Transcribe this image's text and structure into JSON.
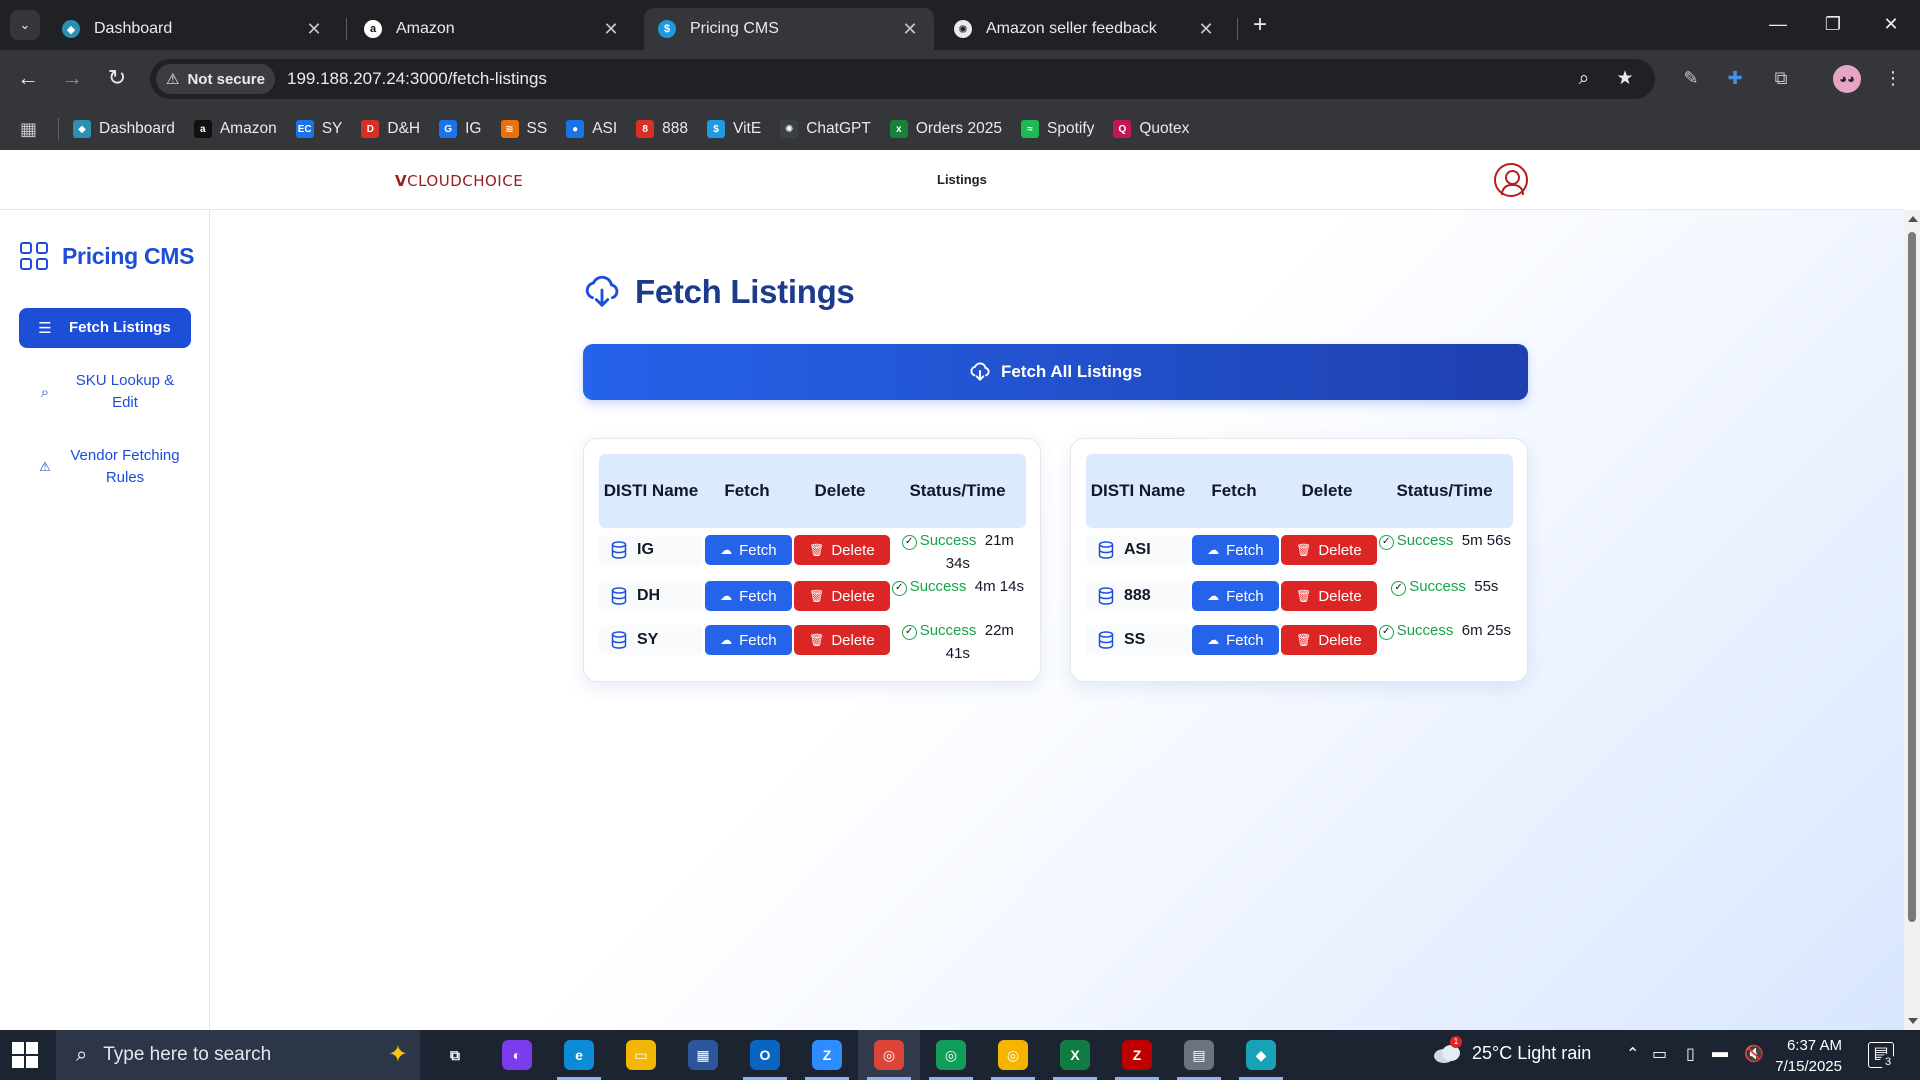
{
  "browser": {
    "tabs": [
      {
        "title": "Dashboard",
        "icon": "dashboard-favicon",
        "icon_color": "#2b8fb0",
        "active": false
      },
      {
        "title": "Amazon",
        "icon": "amazon-favicon",
        "icon_color": "#ffffff",
        "active": false
      },
      {
        "title": "Pricing CMS",
        "icon": "dollar-favicon",
        "icon_color": "#1f9ae0",
        "active": true
      },
      {
        "title": "Amazon seller feedback",
        "icon": "chatgpt-favicon",
        "icon_color": "#e8eaed",
        "active": false
      }
    ],
    "security_label": "Not secure",
    "url": "199.188.207.24:3000/fetch-listings",
    "bookmarks": [
      {
        "label": "Dashboard",
        "icon": "dashboard-bookmark-icon",
        "color": "#2b8fb0",
        "glyph": "◆"
      },
      {
        "label": "Amazon",
        "icon": "amazon-bookmark-icon",
        "color": "#111111",
        "glyph": "a"
      },
      {
        "label": "SY",
        "icon": "sy-bookmark-icon",
        "color": "#1a73e8",
        "glyph": "EC"
      },
      {
        "label": "D&H",
        "icon": "dh-bookmark-icon",
        "color": "#d93025",
        "glyph": "D"
      },
      {
        "label": "IG",
        "icon": "ig-bookmark-icon",
        "color": "#1a73e8",
        "glyph": "G"
      },
      {
        "label": "SS",
        "icon": "ss-bookmark-icon",
        "color": "#e8710a",
        "glyph": "≋"
      },
      {
        "label": "ASI",
        "icon": "asi-bookmark-icon",
        "color": "#1a73e8",
        "glyph": "●"
      },
      {
        "label": "888",
        "icon": "888-bookmark-icon",
        "color": "#d93025",
        "glyph": "8"
      },
      {
        "label": "VitE",
        "icon": "vite-bookmark-icon",
        "color": "#1f9ae0",
        "glyph": "$"
      },
      {
        "label": "ChatGPT",
        "icon": "chatgpt-bookmark-icon",
        "color": "#3c4043",
        "glyph": "✺"
      },
      {
        "label": "Orders 2025",
        "icon": "orders-bookmark-icon",
        "color": "#188038",
        "glyph": "x"
      },
      {
        "label": "Spotify",
        "icon": "spotify-bookmark-icon",
        "color": "#1db954",
        "glyph": "≈"
      },
      {
        "label": "Quotex",
        "icon": "quotex-bookmark-icon",
        "color": "#c2185b",
        "glyph": "Q"
      }
    ]
  },
  "app": {
    "logo_prefix": "V",
    "logo_text": "CLOUDCHOICE",
    "header_link": "Listings",
    "brand": "Pricing CMS",
    "sidebar": [
      {
        "label": "Fetch Listings",
        "icon": "list-icon",
        "glyph": "☰",
        "active": true
      },
      {
        "label": "SKU Lookup & Edit",
        "icon": "search-icon",
        "glyph": "⌕",
        "active": false
      },
      {
        "label": "Vendor Fetching Rules",
        "icon": "warning-icon",
        "glyph": "⚠",
        "active": false
      }
    ],
    "page_title": "Fetch Listings",
    "fetch_all_label": "Fetch All Listings",
    "table_headers": [
      "DISTI Name",
      "Fetch",
      "Delete",
      "Status/Time"
    ],
    "fetch_label": "Fetch",
    "delete_label": "Delete",
    "tables": [
      {
        "rows": [
          {
            "name": "IG",
            "status": "Success",
            "time": "21m 34s"
          },
          {
            "name": "DH",
            "status": "Success",
            "time": "4m 14s"
          },
          {
            "name": "SY",
            "status": "Success",
            "time": "22m 41s"
          }
        ]
      },
      {
        "rows": [
          {
            "name": "ASI",
            "status": "Success",
            "time": "5m 56s"
          },
          {
            "name": "888",
            "status": "Success",
            "time": "55s"
          },
          {
            "name": "SS",
            "status": "Success",
            "time": "6m 25s"
          }
        ]
      }
    ],
    "colors": {
      "primary": "#1d4ed8",
      "danger": "#dc2626",
      "success": "#16a34a",
      "header_bg": "#dbeafe"
    }
  },
  "taskbar": {
    "search_placeholder": "Type here to search",
    "weather": "25°C  Light rain",
    "weather_badge": "1",
    "time": "6:37 AM",
    "date": "7/15/2025",
    "notification_count": "3",
    "apps": [
      {
        "name": "task-view-icon",
        "glyph": "⧉",
        "color": "transparent"
      },
      {
        "name": "copilot-icon",
        "glyph": "◐",
        "color": "#7c3aed"
      },
      {
        "name": "edge-icon",
        "glyph": "e",
        "color": "#0c8bd6"
      },
      {
        "name": "file-explorer-icon",
        "glyph": "▭",
        "color": "#f2b705"
      },
      {
        "name": "microsoft-store-icon",
        "glyph": "▦",
        "color": "#2b579a"
      },
      {
        "name": "outlook-icon",
        "glyph": "O",
        "color": "#0a64c2"
      },
      {
        "name": "zoom-icon",
        "glyph": "Z",
        "color": "#2d8cff"
      },
      {
        "name": "chrome-icon",
        "glyph": "◎",
        "color": "#db4437"
      },
      {
        "name": "chrome-profile-icon",
        "glyph": "◎",
        "color": "#0f9d58"
      },
      {
        "name": "chrome-alt-icon",
        "glyph": "◎",
        "color": "#f4b400"
      },
      {
        "name": "excel-icon",
        "glyph": "X",
        "color": "#107c41"
      },
      {
        "name": "filezilla-icon",
        "glyph": "Z",
        "color": "#bf0000"
      },
      {
        "name": "calculator-icon",
        "glyph": "▤",
        "color": "#6b7280"
      },
      {
        "name": "app-icon",
        "glyph": "◆",
        "color": "#17a2b8"
      }
    ]
  }
}
